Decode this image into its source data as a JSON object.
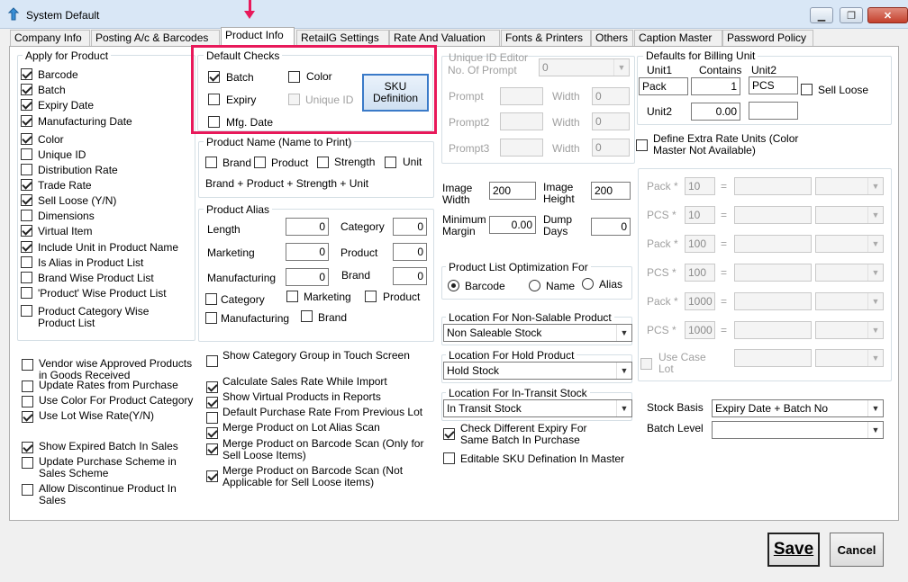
{
  "window": {
    "title": "System Default"
  },
  "tabs": [
    "Company Info",
    "Posting A/c & Barcodes",
    "Product Info",
    "RetailG Settings",
    "Rate And Valuation",
    "Fonts & Printers",
    "Others",
    "Caption Master",
    "Password Policy"
  ],
  "apply": {
    "title": "Apply for Product",
    "items": [
      {
        "label": "Barcode",
        "checked": true
      },
      {
        "label": "Batch",
        "checked": true
      },
      {
        "label": "Expiry Date",
        "checked": true
      },
      {
        "label": "Manufacturing Date",
        "checked": true
      },
      {
        "label": "Color",
        "checked": true
      },
      {
        "label": "Unique ID",
        "checked": false
      },
      {
        "label": "Distribution Rate",
        "checked": false
      },
      {
        "label": "Trade Rate",
        "checked": true
      },
      {
        "label": "Sell Loose (Y/N)",
        "checked": true
      },
      {
        "label": "Dimensions",
        "checked": false
      },
      {
        "label": "Virtual Item",
        "checked": true
      },
      {
        "label": "Include Unit in Product Name",
        "checked": true
      },
      {
        "label": "Is Alias in Product List",
        "checked": false
      },
      {
        "label": "Brand Wise Product List",
        "checked": false
      },
      {
        "label": "'Product' Wise Product List",
        "checked": false
      },
      {
        "label": "Product Category Wise Product List",
        "checked": false
      }
    ]
  },
  "left_options": [
    {
      "label": "Vendor wise Approved Products in Goods Received",
      "checked": false
    },
    {
      "label": "Update Rates from Purchase",
      "checked": false
    },
    {
      "label": "Use Color For Product Category",
      "checked": false
    },
    {
      "label": "Use Lot Wise Rate(Y/N)",
      "checked": true
    },
    {
      "label": "Show Expired Batch In Sales",
      "checked": true
    },
    {
      "label": "Update Purchase Scheme in Sales Scheme",
      "checked": false
    },
    {
      "label": "Allow Discontinue Product In Sales",
      "checked": false
    }
  ],
  "default_checks": {
    "title": "Default Checks",
    "batch": "Batch",
    "color": "Color",
    "expiry": "Expiry",
    "unique_id": "Unique ID",
    "mfg_date": "Mfg. Date",
    "sku_button": "SKU Definition"
  },
  "product_name": {
    "title": "Product Name (Name to Print)",
    "brand": "Brand",
    "product": "Product",
    "strength": "Strength",
    "unit": "Unit",
    "formula": "Brand + Product + Strength + Unit"
  },
  "product_alias": {
    "title": "Product Alias",
    "length_label": "Length",
    "length": "0",
    "category_label": "Category",
    "category": "0",
    "marketing_label": "Marketing",
    "marketing": "0",
    "product_label": "Product",
    "product": "0",
    "manufacturing_label": "Manufacturing",
    "manufacturing": "0",
    "brand_label": "Brand",
    "brand": "0",
    "chk_category": "Category",
    "chk_marketing": "Marketing",
    "chk_product": "Product",
    "chk_manufacturing": "Manufacturing",
    "chk_brand": "Brand"
  },
  "mid_options": [
    {
      "label": "Show Category Group in Touch Screen",
      "checked": false
    },
    {
      "label": "Calculate Sales Rate While Import",
      "checked": true
    },
    {
      "label": "Show Virtual Products in Reports",
      "checked": true
    },
    {
      "label": "Default Purchase Rate From Previous Lot",
      "checked": false
    },
    {
      "label": "Merge Product on Lot Alias Scan",
      "checked": true
    },
    {
      "label": "Merge Product on Barcode Scan (Only for Sell Loose Items)",
      "checked": true
    },
    {
      "label": "Merge Product on Barcode Scan (Not Applicable for Sell Loose items)",
      "checked": true
    }
  ],
  "unique_id_editor": {
    "title": "Unique ID Editor",
    "no_of_prompt_label": "No. Of Prompt",
    "no_of_prompt": "0",
    "prompt": "Prompt",
    "prompt2": "Prompt2",
    "prompt3": "Prompt3",
    "width_label": "Width",
    "width": "0"
  },
  "image": {
    "width_label": "Image Width",
    "width": "200",
    "height_label": "Image Height",
    "height": "200",
    "min_margin_label": "Minimum Margin",
    "min_margin": "0.00",
    "dump_days_label": "Dump Days",
    "dump_days": "0"
  },
  "optimization": {
    "title": "Product List Optimization For",
    "options": [
      "Barcode",
      "Name",
      "Alias"
    ],
    "selected": "Barcode"
  },
  "location_non_salable": {
    "title": "Location For Non-Salable Product",
    "value": "Non Saleable Stock"
  },
  "location_hold": {
    "title": "Location For Hold Product",
    "value": "Hold Stock"
  },
  "location_transit": {
    "title": "Location For In-Transit Stock",
    "value": "In Transit Stock"
  },
  "expiry_check": {
    "label": "Check Different Expiry For Same Batch In Purchase",
    "checked": true
  },
  "editable_sku": {
    "label": "Editable SKU Defination In Master",
    "checked": false
  },
  "billing": {
    "title": "Defaults for Billing Unit",
    "unit1_label": "Unit1",
    "contains_label": "Contains",
    "unit2_label": "Unit2",
    "unit1": "Pack",
    "contains": "1",
    "unit2": "PCS",
    "sell_loose": "Sell Loose",
    "unit2_row_label": "Unit2",
    "unit2_value": "0.00"
  },
  "extra_rate": {
    "label": "Define Extra Rate Units (Color Master Not Available)",
    "checked": false
  },
  "rate_units": [
    {
      "label": "Pack *",
      "value": "10"
    },
    {
      "label": "PCS *",
      "value": "10"
    },
    {
      "label": "Pack *",
      "value": "100"
    },
    {
      "label": "PCS *",
      "value": "100"
    },
    {
      "label": "Pack *",
      "value": "1000"
    },
    {
      "label": "PCS *",
      "value": "1000"
    }
  ],
  "eq_sign": "=",
  "use_case_lot": "Use Case Lot",
  "stock_basis": {
    "label": "Stock Basis",
    "value": "Expiry Date + Batch No"
  },
  "batch_level": {
    "label": "Batch Level",
    "value": ""
  },
  "buttons": {
    "save": "Save",
    "cancel": "Cancel"
  },
  "colors": {
    "highlight": "#e8195a",
    "titlebar": "#d9e7f6"
  },
  "icons": {
    "app": "app-icon",
    "minimize": "minimize-icon",
    "maximize": "maximize-icon",
    "close": "close-icon"
  }
}
